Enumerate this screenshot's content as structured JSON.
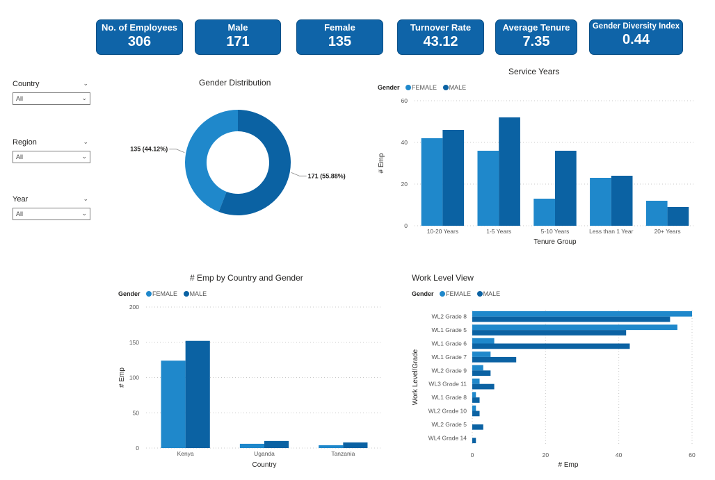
{
  "kpis": [
    {
      "label": "No. of Employees",
      "value": "306"
    },
    {
      "label": "Male",
      "value": "171"
    },
    {
      "label": "Female",
      "value": "135"
    },
    {
      "label": "Turnover Rate",
      "value": "43.12"
    },
    {
      "label": "Average Tenure",
      "value": "7.35"
    },
    {
      "label": "Gender Diversity Index",
      "value": "0.44"
    }
  ],
  "filters": [
    {
      "label": "Country",
      "value": "All"
    },
    {
      "label": "Region",
      "value": "All"
    },
    {
      "label": "Year",
      "value": "All"
    }
  ],
  "colors": {
    "female": "#1f88cb",
    "male": "#0b62a3",
    "kpi_bg": "#0f64a8"
  },
  "legend": {
    "title": "Gender",
    "female": "FEMALE",
    "male": "MALE"
  },
  "chart_data": [
    {
      "id": "gender_distribution",
      "type": "pie",
      "title": "Gender Distribution",
      "slices": [
        {
          "name": "FEMALE",
          "value": 135,
          "label": "135 (44.12%)"
        },
        {
          "name": "MALE",
          "value": 171,
          "label": "171 (55.88%)"
        }
      ]
    },
    {
      "id": "service_years",
      "type": "bar",
      "title": "Service Years",
      "xlabel": "Tenure Group",
      "ylabel": "# Emp",
      "ylim": [
        0,
        60
      ],
      "yticks": [
        0,
        20,
        40,
        60
      ],
      "categories": [
        "10-20 Years",
        "1-5 Years",
        "5-10 Years",
        "Less than 1 Year",
        "20+ Years"
      ],
      "series": [
        {
          "name": "FEMALE",
          "values": [
            42,
            36,
            13,
            23,
            12
          ]
        },
        {
          "name": "MALE",
          "values": [
            46,
            52,
            36,
            24,
            9
          ]
        }
      ]
    },
    {
      "id": "emp_by_country",
      "type": "bar",
      "title": "# Emp by Country and Gender",
      "xlabel": "Country",
      "ylabel": "# Emp",
      "ylim": [
        0,
        200
      ],
      "yticks": [
        0,
        50,
        100,
        150,
        200
      ],
      "categories": [
        "Kenya",
        "Uganda",
        "Tanzania"
      ],
      "series": [
        {
          "name": "FEMALE",
          "values": [
            124,
            6,
            4
          ]
        },
        {
          "name": "MALE",
          "values": [
            152,
            10,
            8
          ]
        }
      ]
    },
    {
      "id": "work_level",
      "type": "bar",
      "orientation": "horizontal",
      "title": "Work Level View",
      "xlabel": "# Emp",
      "ylabel": "Work Level/Grade",
      "xlim": [
        0,
        60
      ],
      "xticks": [
        0,
        20,
        40,
        60
      ],
      "categories": [
        "WL2 Grade 8",
        "WL1 Grade 5",
        "WL1 Grade 6",
        "WL1 Grade 7",
        "WL2 Grade 9",
        "WL3 Grade 11",
        "WL1 Grade 8",
        "WL2 Grade 10",
        "WL2 Grade 5",
        "WL4 Grade 14"
      ],
      "series": [
        {
          "name": "FEMALE",
          "values": [
            60,
            56,
            6,
            5,
            3,
            2,
            1,
            1,
            0,
            0
          ]
        },
        {
          "name": "MALE",
          "values": [
            54,
            42,
            43,
            12,
            5,
            6,
            2,
            2,
            3,
            1
          ]
        }
      ]
    }
  ]
}
